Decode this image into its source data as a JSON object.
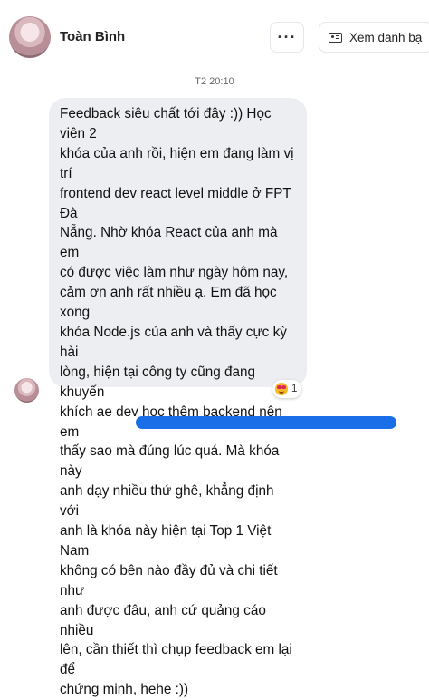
{
  "header": {
    "contact_name": "Toàn Bình",
    "more_label": "···",
    "profile_button_label": "Xem danh bạ",
    "profile_icon": "contact-card-icon",
    "more_icon": "more-dots-icon"
  },
  "conversation": {
    "timestamp": "T2 20:10",
    "message_lines": [
      "Feedback siêu chất tới đây :)) Học viên 2",
      "khóa của anh rồi, hiện em đang làm vị trí",
      "frontend dev react level middle ở FPT Đà",
      "Nẵng. Nhờ khóa React của anh mà em",
      "có được việc làm như ngày hôm nay,",
      "cảm ơn anh rất nhiều ạ. Em đã học xong",
      "khóa Node.js của anh và thấy cực kỳ hài",
      "lòng, hiện tại công ty cũng đang khuyến",
      "khích ae dev học thêm backend nên em",
      "thấy sao mà đúng lúc quá. Mà khóa này",
      "anh dạy nhiều thứ ghê, khẳng định với",
      "anh là khóa này hiện tại Top 1 Việt Nam",
      "không có bên nào đầy đủ và chi tiết như",
      "anh được đâu, anh cứ quảng cáo nhiều",
      "lên, cần thiết thì chụp feedback em lại để",
      "chứng minh, hehe :))"
    ],
    "reaction": {
      "icon": "heart-eyes-emoji-icon",
      "count": "1"
    }
  },
  "colors": {
    "bubble_bg": "#eceef1",
    "accent": "#1a6fe8",
    "timestamp": "#65676b"
  }
}
